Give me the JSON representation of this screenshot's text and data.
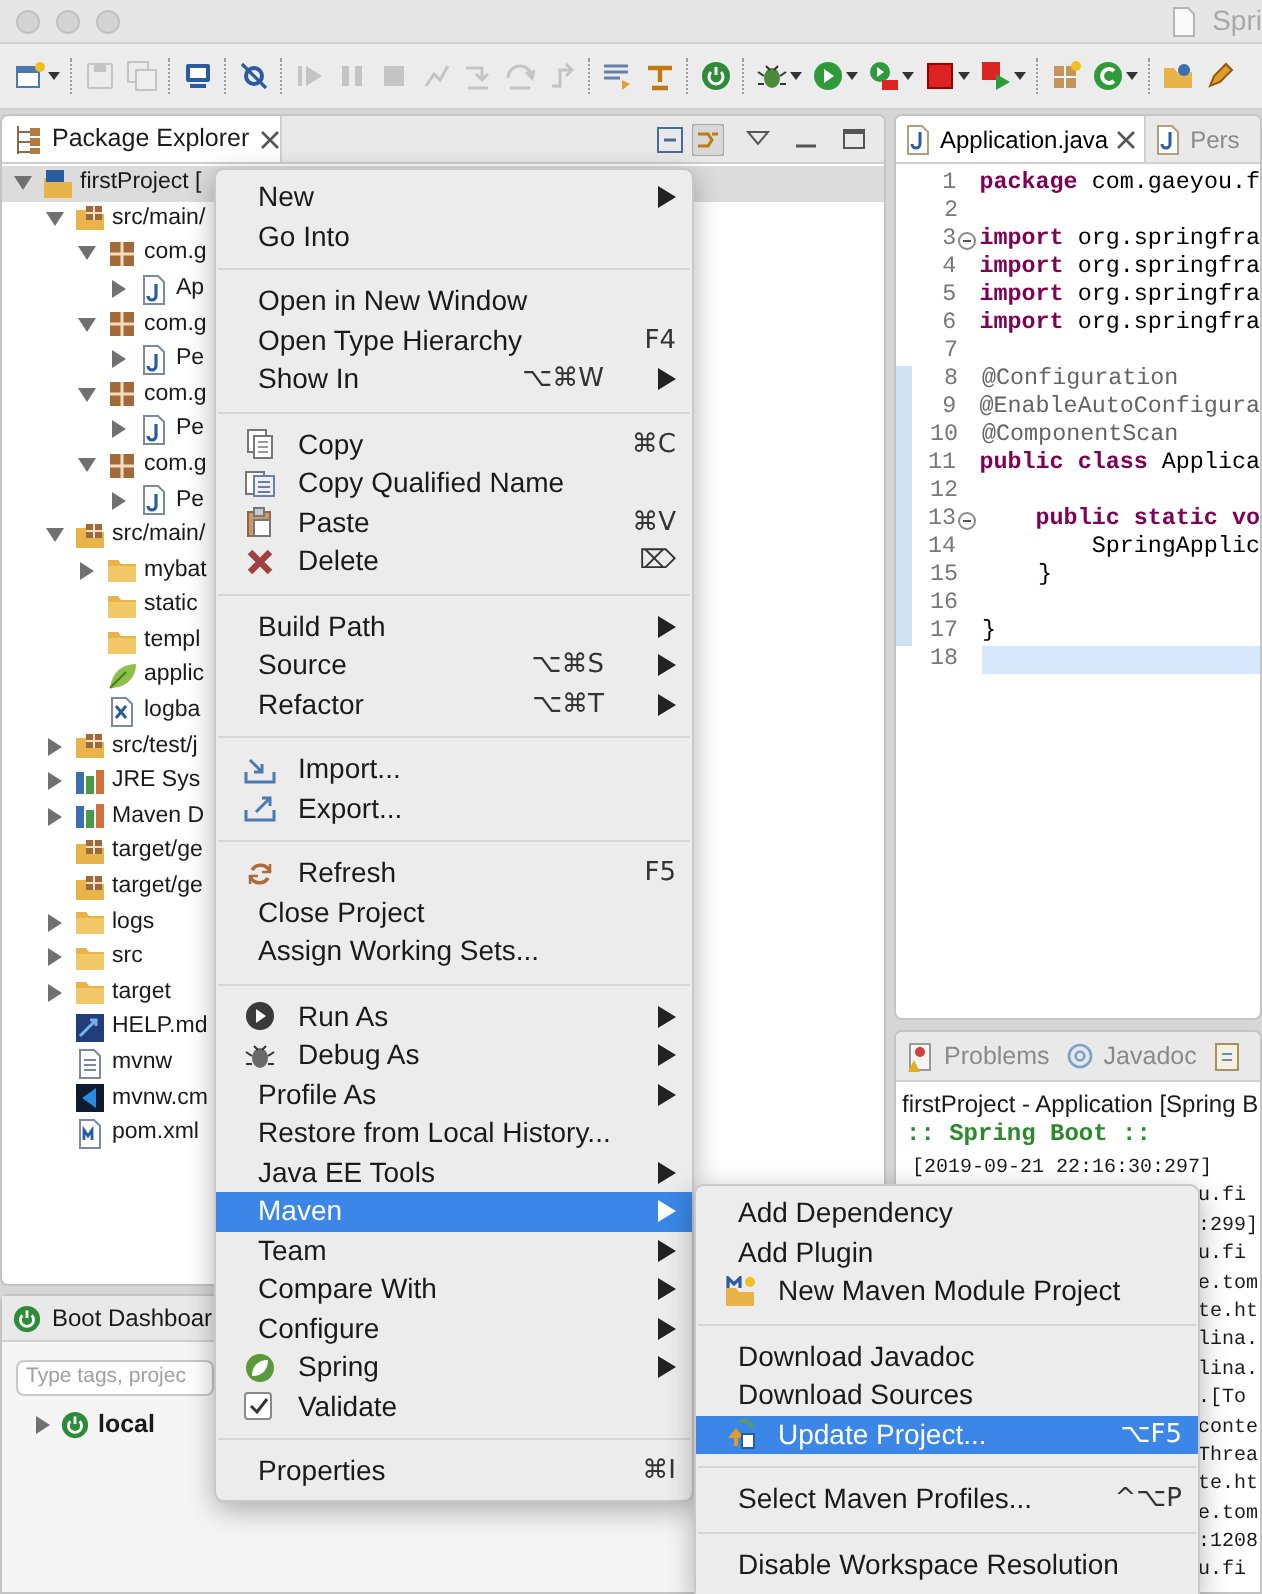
{
  "window": {
    "title": "Spri"
  },
  "toolbar": [
    {
      "kind": "new-wizard",
      "disabled": false,
      "dropdown": true
    },
    {
      "kind": "separator"
    },
    {
      "kind": "save",
      "disabled": true,
      "dropdown": false
    },
    {
      "kind": "save-all",
      "disabled": true,
      "dropdown": false
    },
    {
      "kind": "separator"
    },
    {
      "kind": "monitor",
      "disabled": false,
      "dropdown": false
    },
    {
      "kind": "separator"
    },
    {
      "kind": "skip-breakpoints",
      "disabled": false,
      "dropdown": false
    },
    {
      "kind": "separator"
    },
    {
      "kind": "resume",
      "disabled": true,
      "dropdown": false
    },
    {
      "kind": "suspend",
      "disabled": true,
      "dropdown": false
    },
    {
      "kind": "terminate",
      "disabled": true,
      "dropdown": false
    },
    {
      "kind": "disconnect",
      "disabled": true,
      "dropdown": false
    },
    {
      "kind": "step-into",
      "disabled": true,
      "dropdown": false
    },
    {
      "kind": "step-over",
      "disabled": true,
      "dropdown": false
    },
    {
      "kind": "step-return",
      "disabled": true,
      "dropdown": false
    },
    {
      "kind": "separator"
    },
    {
      "kind": "list",
      "disabled": false,
      "dropdown": false
    },
    {
      "kind": "tool",
      "disabled": false,
      "dropdown": false
    },
    {
      "kind": "separator"
    },
    {
      "kind": "power",
      "disabled": false,
      "dropdown": false
    },
    {
      "kind": "separator"
    },
    {
      "kind": "debug",
      "disabled": false,
      "dropdown": true
    },
    {
      "kind": "run",
      "disabled": false,
      "dropdown": true
    },
    {
      "kind": "run-ext",
      "disabled": false,
      "dropdown": true
    },
    {
      "kind": "stop",
      "disabled": false,
      "dropdown": true
    },
    {
      "kind": "red-run",
      "disabled": false,
      "dropdown": true
    },
    {
      "kind": "separator"
    },
    {
      "kind": "grid",
      "disabled": false,
      "dropdown": false
    },
    {
      "kind": "refresh",
      "disabled": false,
      "dropdown": true
    },
    {
      "kind": "separator"
    },
    {
      "kind": "folder",
      "disabled": false,
      "dropdown": false
    },
    {
      "kind": "pen",
      "disabled": false,
      "dropdown": false
    }
  ],
  "package_explorer": {
    "tab": "Package Explorer",
    "tree": [
      {
        "label": "firstProject [",
        "kind": "project",
        "expanded": true,
        "selected": true,
        "children": [
          {
            "label": "src/main/",
            "kind": "srcfolder",
            "expanded": true,
            "selected": false,
            "children": [
              {
                "label": "com.g",
                "kind": "package",
                "expanded": true,
                "selected": false,
                "children": [
                  {
                    "label": "Ap",
                    "kind": "java",
                    "expanded": false,
                    "selected": false
                  }
                ]
              },
              {
                "label": "com.g",
                "kind": "package",
                "expanded": true,
                "selected": false,
                "children": [
                  {
                    "label": "Pe",
                    "kind": "java",
                    "expanded": false,
                    "selected": false
                  }
                ]
              },
              {
                "label": "com.g",
                "kind": "package",
                "expanded": true,
                "selected": false,
                "children": [
                  {
                    "label": "Pe",
                    "kind": "java",
                    "expanded": false,
                    "selected": false
                  }
                ]
              },
              {
                "label": "com.g",
                "kind": "package",
                "expanded": true,
                "selected": false,
                "children": [
                  {
                    "label": "Pe",
                    "kind": "java",
                    "expanded": false,
                    "selected": false
                  }
                ]
              }
            ]
          },
          {
            "label": "src/main/",
            "kind": "srcfolder",
            "expanded": true,
            "selected": false,
            "children": [
              {
                "label": "mybat",
                "kind": "folder",
                "expanded": false,
                "selected": false
              },
              {
                "label": "static",
                "kind": "folder",
                "selected": false
              },
              {
                "label": "templ",
                "kind": "folder",
                "selected": false
              },
              {
                "label": "applic",
                "kind": "leaf",
                "selected": false
              },
              {
                "label": "logba",
                "kind": "xml",
                "selected": false
              }
            ]
          },
          {
            "label": "src/test/j",
            "kind": "srcfolder",
            "expanded": false,
            "selected": false
          },
          {
            "label": "JRE Sys",
            "kind": "library",
            "expanded": false,
            "selected": false
          },
          {
            "label": "Maven D",
            "kind": "library",
            "expanded": false,
            "selected": false
          },
          {
            "label": "target/ge",
            "kind": "srcfolder",
            "selected": false
          },
          {
            "label": "target/ge",
            "kind": "srcfolder",
            "selected": false
          },
          {
            "label": "logs",
            "kind": "folder",
            "expanded": false,
            "selected": false
          },
          {
            "label": "src",
            "kind": "folder",
            "expanded": false,
            "selected": false
          },
          {
            "label": "target",
            "kind": "folder",
            "expanded": false,
            "selected": false
          },
          {
            "label": "HELP.md",
            "kind": "markdown",
            "selected": false
          },
          {
            "label": "mvnw",
            "kind": "text",
            "selected": false
          },
          {
            "label": "mvnw.cm",
            "kind": "vscode",
            "selected": false
          },
          {
            "label": "pom.xml",
            "kind": "pom",
            "selected": false
          }
        ]
      }
    ]
  },
  "boot_dashboard": {
    "tab": "Boot Dashboar",
    "search": {
      "placeholder": "Type tags, projec"
    },
    "tree": [
      {
        "label": "local",
        "expanded": false,
        "selected": false
      }
    ]
  },
  "editor": {
    "tabs": [
      {
        "label": "Application.java",
        "selected": true
      },
      {
        "label": "Pers",
        "selected": false
      }
    ],
    "lines": [
      {
        "number": "1",
        "fold": false,
        "changed": false,
        "current": false,
        "tokens": [
          {
            "text": "package",
            "kind": "keyword"
          },
          {
            "text": " com.gaeyou.f",
            "kind": "plain"
          }
        ]
      },
      {
        "number": "2",
        "fold": false,
        "changed": false,
        "current": false
      },
      {
        "number": "3",
        "fold": true,
        "changed": false,
        "current": false,
        "tokens": [
          {
            "text": "import",
            "kind": "keyword"
          },
          {
            "text": " org.springfra",
            "kind": "plain"
          }
        ]
      },
      {
        "number": "4",
        "fold": false,
        "changed": false,
        "current": false,
        "tokens": [
          {
            "text": "import",
            "kind": "keyword"
          },
          {
            "text": " org.springfra",
            "kind": "plain"
          }
        ]
      },
      {
        "number": "5",
        "fold": false,
        "changed": false,
        "current": false,
        "tokens": [
          {
            "text": "import",
            "kind": "keyword"
          },
          {
            "text": " org.springfra",
            "kind": "plain"
          }
        ]
      },
      {
        "number": "6",
        "fold": false,
        "changed": false,
        "current": false,
        "tokens": [
          {
            "text": "import",
            "kind": "keyword"
          },
          {
            "text": " org.springfra",
            "kind": "plain"
          }
        ]
      },
      {
        "number": "7",
        "fold": false,
        "changed": false,
        "current": false
      },
      {
        "number": "8",
        "fold": false,
        "changed": true,
        "current": false,
        "tokens": [
          {
            "text": "@Configuration",
            "kind": "annotation"
          }
        ]
      },
      {
        "number": "9",
        "fold": false,
        "changed": true,
        "current": false,
        "tokens": [
          {
            "text": "@EnableAutoConfigura",
            "kind": "annotation"
          }
        ]
      },
      {
        "number": "10",
        "fold": false,
        "changed": true,
        "current": false,
        "tokens": [
          {
            "text": "@ComponentScan",
            "kind": "annotation"
          }
        ]
      },
      {
        "number": "11",
        "fold": false,
        "changed": true,
        "current": false,
        "tokens": [
          {
            "text": "public class",
            "kind": "keyword"
          },
          {
            "text": " Applica",
            "kind": "plain"
          }
        ]
      },
      {
        "number": "12",
        "fold": false,
        "changed": true,
        "current": false
      },
      {
        "number": "13",
        "fold": true,
        "changed": true,
        "current": false,
        "tokens": [
          {
            "text": "    public static vo",
            "kind": "keyword"
          }
        ]
      },
      {
        "number": "14",
        "fold": false,
        "changed": true,
        "current": false,
        "tokens": [
          {
            "text": "        SpringApplic",
            "kind": "plain"
          }
        ]
      },
      {
        "number": "15",
        "fold": false,
        "changed": true,
        "current": false,
        "tokens": [
          {
            "text": "    }",
            "kind": "plain"
          }
        ]
      },
      {
        "number": "16",
        "fold": false,
        "changed": true,
        "current": false
      },
      {
        "number": "17",
        "fold": false,
        "changed": true,
        "current": false,
        "tokens": [
          {
            "text": "}",
            "kind": "plain"
          }
        ]
      },
      {
        "number": "18",
        "fold": false,
        "changed": false,
        "current": true
      }
    ]
  },
  "console": {
    "tabs": [
      {
        "label": "Problems",
        "kind": "problems"
      },
      {
        "label": "Javadoc",
        "kind": "at"
      },
      {
        "kind": "declaration"
      }
    ],
    "description": "firstProject - Application [Spring B",
    "banner": ":: Spring Boot ::",
    "log": [
      "[2019-09-21 22:16:30:297]",
      "u.fi",
      ":299]",
      "u.fi",
      "e.tom",
      "te.ht",
      "lina.",
      "lina.",
      ".[To",
      "conte",
      "Threa",
      "te.ht",
      "e.tom",
      ":1208",
      "u.fi"
    ]
  },
  "context_menu": {
    "sections": [
      [
        {
          "label": "New",
          "submenu": true,
          "selected": false
        },
        {
          "label": "Go Into",
          "submenu": false,
          "selected": false
        }
      ],
      [
        {
          "label": "Open in New Window",
          "submenu": false,
          "selected": false
        },
        {
          "label": "Open Type Hierarchy",
          "shortcut": "F4",
          "submenu": false,
          "selected": false
        },
        {
          "label": "Show In",
          "shortcut": "⌥⌘W",
          "submenu": true,
          "selected": false
        }
      ],
      [
        {
          "label": "Copy",
          "kind": "copy",
          "shortcut": "⌘C",
          "submenu": false,
          "selected": false
        },
        {
          "label": "Copy Qualified Name",
          "kind": "copy-qualified",
          "submenu": false,
          "selected": false
        },
        {
          "label": "Paste",
          "kind": "paste",
          "shortcut": "⌘V",
          "submenu": false,
          "selected": false
        },
        {
          "label": "Delete",
          "kind": "delete",
          "shortcut": "⌦",
          "submenu": false,
          "selected": false
        }
      ],
      [
        {
          "label": "Build Path",
          "submenu": true,
          "selected": false
        },
        {
          "label": "Source",
          "shortcut": "⌥⌘S",
          "submenu": true,
          "selected": false
        },
        {
          "label": "Refactor",
          "shortcut": "⌥⌘T",
          "submenu": true,
          "selected": false
        }
      ],
      [
        {
          "label": "Import...",
          "kind": "import",
          "submenu": false,
          "selected": false
        },
        {
          "label": "Export...",
          "kind": "export",
          "submenu": false,
          "selected": false
        }
      ],
      [
        {
          "label": "Refresh",
          "kind": "refresh",
          "shortcut": "F5",
          "submenu": false,
          "selected": false
        },
        {
          "label": "Close Project",
          "submenu": false,
          "selected": false
        },
        {
          "label": "Assign Working Sets...",
          "submenu": false,
          "selected": false
        }
      ],
      [
        {
          "label": "Run As",
          "kind": "run",
          "submenu": true,
          "selected": false
        },
        {
          "label": "Debug As",
          "kind": "debug",
          "submenu": true,
          "selected": false
        },
        {
          "label": "Profile As",
          "submenu": true,
          "selected": false
        },
        {
          "label": "Restore from Local History...",
          "submenu": false,
          "selected": false
        },
        {
          "label": "Java EE Tools",
          "submenu": true,
          "selected": false
        },
        {
          "label": "Maven",
          "submenu": true,
          "selected": true
        },
        {
          "label": "Team",
          "submenu": true,
          "selected": false
        },
        {
          "label": "Compare With",
          "submenu": true,
          "selected": false
        },
        {
          "label": "Configure",
          "submenu": true,
          "selected": false
        },
        {
          "label": "Spring",
          "kind": "spring",
          "submenu": true,
          "selected": false
        },
        {
          "label": "Validate",
          "kind": "checkbox",
          "checked": true,
          "submenu": false,
          "selected": false
        }
      ],
      [
        {
          "label": "Properties",
          "shortcut": "⌘I",
          "submenu": false,
          "selected": false
        }
      ]
    ]
  },
  "maven_submenu": {
    "sections": [
      [
        {
          "label": "Add Dependency",
          "selected": false
        },
        {
          "label": "Add Plugin",
          "selected": false
        },
        {
          "label": "New Maven Module Project",
          "kind": "maven-module",
          "selected": false
        }
      ],
      [
        {
          "label": "Download Javadoc",
          "selected": false
        },
        {
          "label": "Download Sources",
          "selected": false
        },
        {
          "label": "Update Project...",
          "kind": "update",
          "shortcut": "⌥F5",
          "selected": true
        }
      ],
      [
        {
          "label": "Select Maven Profiles...",
          "shortcut": "^⌥P",
          "selected": false
        }
      ],
      [
        {
          "label": "Disable Workspace Resolution",
          "selected": false
        }
      ]
    ]
  }
}
